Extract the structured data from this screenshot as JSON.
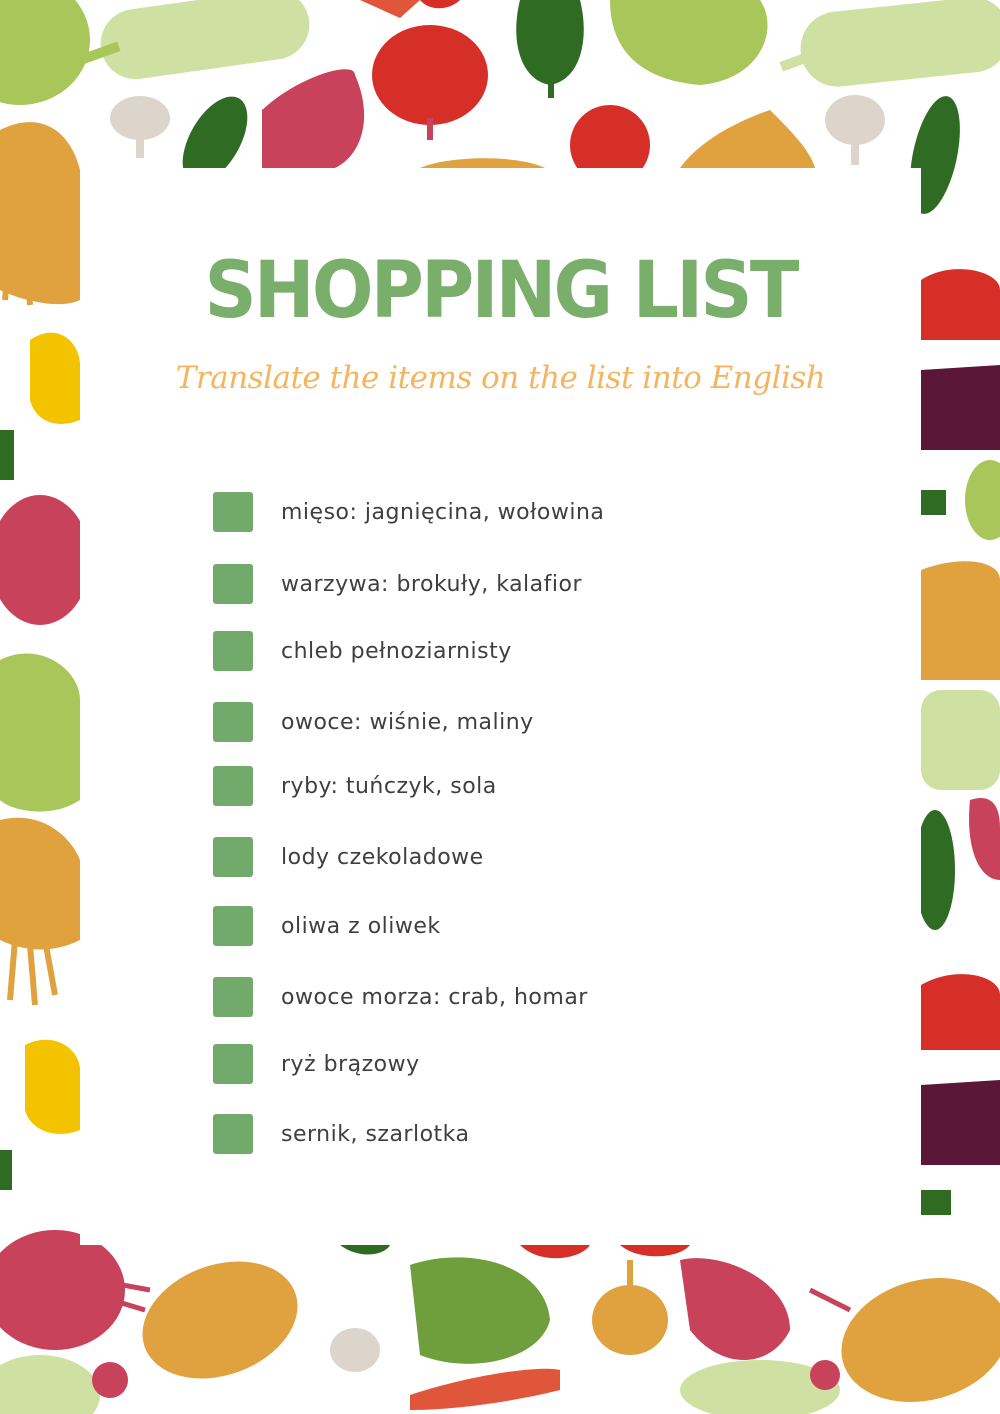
{
  "title": "SHOPPING LIST",
  "subtitle": "Translate the items on the list into English",
  "colors": {
    "title": "#7aae6b",
    "subtitle": "#f5b45e",
    "checkbox": "#72aa6b",
    "item_text": "#3f3f3f",
    "veg_red": "#d62f27",
    "veg_beet": "#c9425b",
    "veg_green_light": "#a8c65a",
    "veg_green_dark": "#2f6b22",
    "veg_orange": "#e0a23e",
    "veg_yellow": "#f3c300",
    "veg_pale_green": "#cfe0a3",
    "veg_eggplant": "#5a1738",
    "veg_garlic": "#ddd4cc"
  },
  "items": [
    {
      "label": "mięso: jagnięcina, wołowina"
    },
    {
      "label": "warzywa: brokuły, kalafior"
    },
    {
      "label": "chleb pełnoziarnisty"
    },
    {
      "label": "owoce: wiśnie, maliny"
    },
    {
      "label": "ryby: tuńczyk, sola"
    },
    {
      "label": "lody czekoladowe"
    },
    {
      "label": "oliwa z oliwek"
    },
    {
      "label": "owoce morza: crab, homar"
    },
    {
      "label": "ryż brązowy"
    },
    {
      "label": "sernik, szarlotka"
    }
  ]
}
